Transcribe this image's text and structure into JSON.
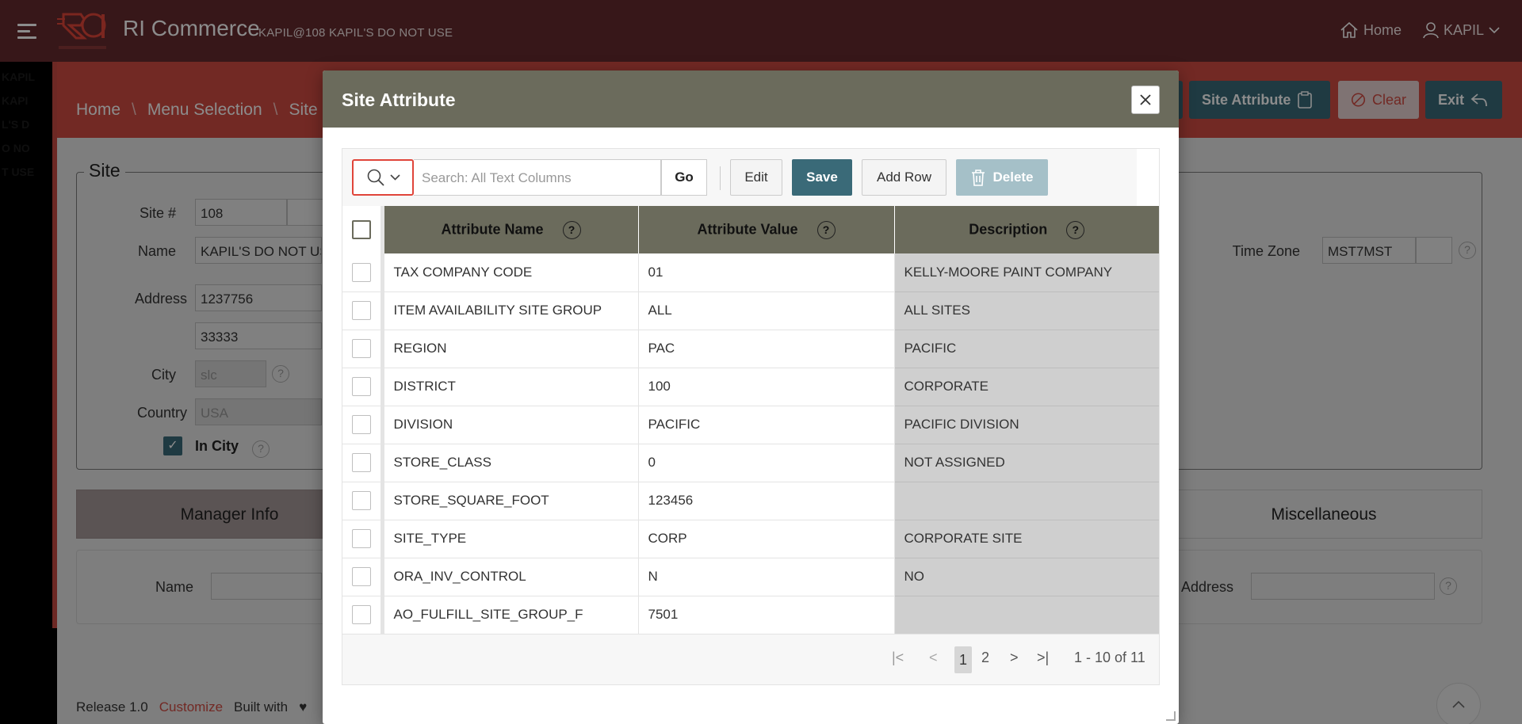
{
  "app": {
    "title": "RI Commerce",
    "subtitle": "KAPIL@108 KAPIL'S DO NOT USE",
    "home_label": "Home",
    "user_label": "KAPIL",
    "sidebar_ghost": "KAPIL KAPIL'S DO NOT USE"
  },
  "breadcrumb": {
    "home": "Home",
    "menu": "Menu Selection",
    "site": "Site In"
  },
  "header_buttons": {
    "site_attribute": "Site Attribute",
    "clear": "Clear",
    "exit": "Exit"
  },
  "site_form": {
    "legend": "Site",
    "site_no_label": "Site #",
    "site_no": "108",
    "name_label": "Name",
    "name": "KAPIL'S DO NOT US",
    "address_label": "Address",
    "address1": "1237756",
    "address2": "33333",
    "city_label": "City",
    "city": "slc",
    "country_label": "Country",
    "country": "USA",
    "in_city_label": "In City",
    "time_zone_label": "Time Zone",
    "time_zone": "MST7MST"
  },
  "tabs": {
    "manager_info": "Manager Info",
    "miscellaneous": "Miscellaneous"
  },
  "manager_panel": {
    "name_label": "Name",
    "address_label": "Address"
  },
  "footer": {
    "release": "Release 1.0",
    "customize": "Customize",
    "built_with": "Built with"
  },
  "dialog": {
    "title": "Site Attribute",
    "search_placeholder": "Search: All Text Columns",
    "go_label": "Go",
    "edit_label": "Edit",
    "save_label": "Save",
    "add_row_label": "Add Row",
    "delete_label": "Delete",
    "columns": [
      "Attribute Name",
      "Attribute Value",
      "Description"
    ],
    "rows": [
      {
        "name": "TAX COMPANY CODE",
        "value": "01",
        "desc": "KELLY-MOORE PAINT COMPANY"
      },
      {
        "name": "ITEM AVAILABILITY SITE GROUP",
        "value": "ALL",
        "desc": "ALL SITES"
      },
      {
        "name": "REGION",
        "value": "PAC",
        "desc": "PACIFIC"
      },
      {
        "name": "DISTRICT",
        "value": "100",
        "desc": "CORPORATE"
      },
      {
        "name": "DIVISION",
        "value": "PACIFIC",
        "desc": "PACIFIC DIVISION"
      },
      {
        "name": "STORE_CLASS",
        "value": "0",
        "desc": "NOT ASSIGNED"
      },
      {
        "name": "STORE_SQUARE_FOOT",
        "value": "123456",
        "desc": ""
      },
      {
        "name": "SITE_TYPE",
        "value": "CORP",
        "desc": "CORPORATE SITE"
      },
      {
        "name": "ORA_INV_CONTROL",
        "value": "N",
        "desc": "NO"
      },
      {
        "name": "AO_FULFILL_SITE_GROUP_F",
        "value": "7501",
        "desc": ""
      }
    ],
    "pagination": {
      "page1": "1",
      "page2": "2",
      "range": "1 - 10 of 11"
    }
  },
  "colors": {
    "topbar": "#652b2e",
    "accent_red": "#cf4b42",
    "teal": "#3a6a78",
    "dialog_header": "#6b6b5c"
  }
}
